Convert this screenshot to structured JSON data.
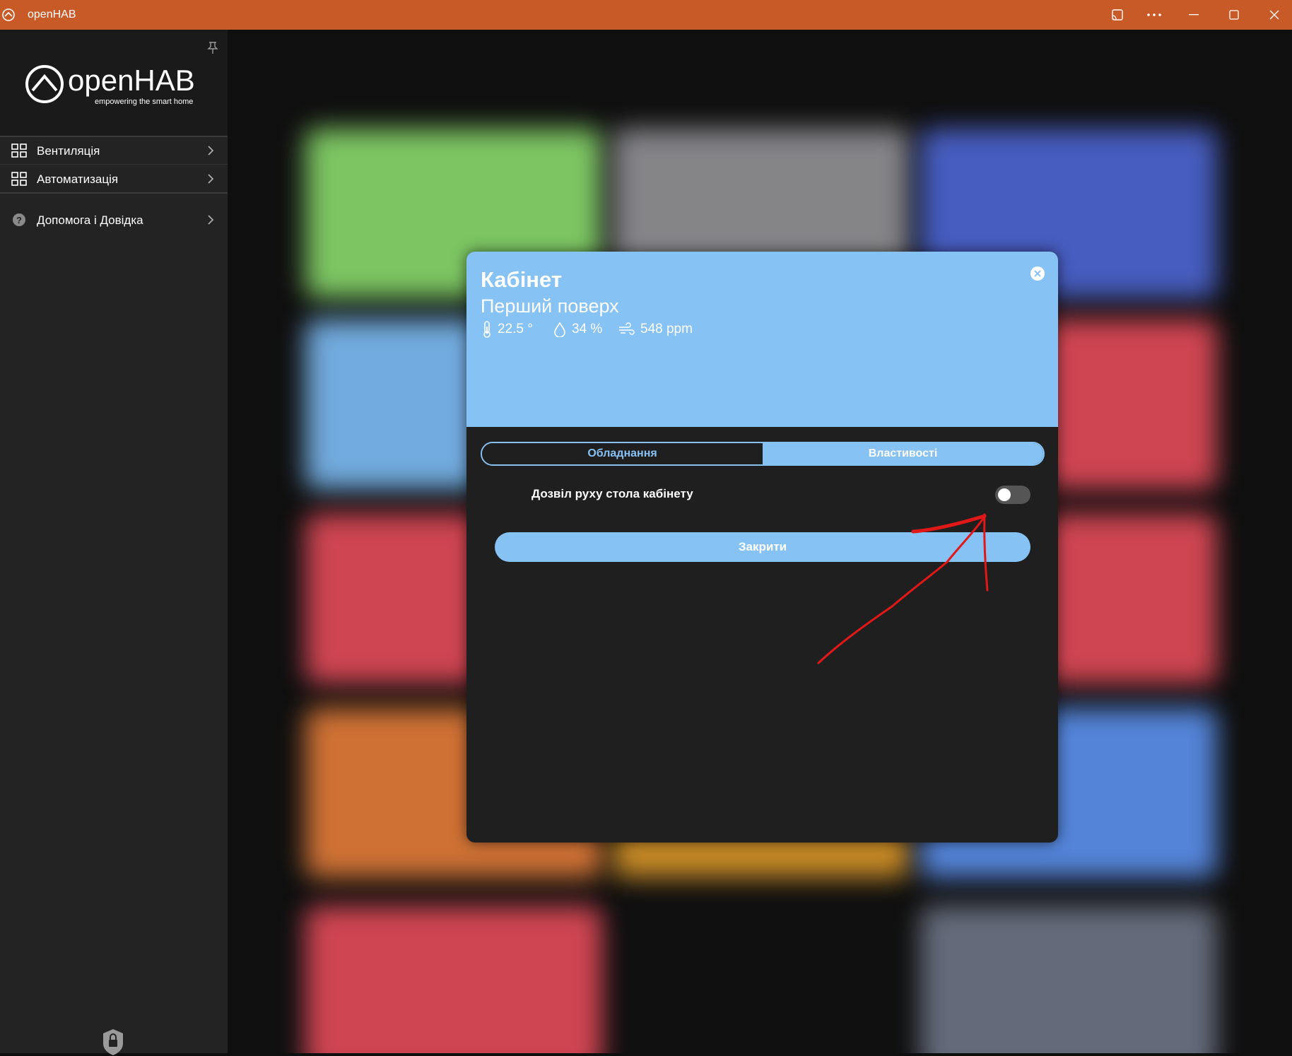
{
  "window": {
    "title": "openHAB"
  },
  "sidebar": {
    "logo_text": "openHAB",
    "logo_tagline": "empowering the smart home",
    "items": [
      {
        "label": "Вентиляція",
        "icon": "grid-icon"
      },
      {
        "label": "Автоматизація",
        "icon": "grid-icon"
      },
      {
        "label": "Допомога і Довідка",
        "icon": "help-icon"
      }
    ]
  },
  "dialog": {
    "title": "Кабінет",
    "subtitle": "Перший поверх",
    "stats": {
      "temperature": "22.5 °",
      "humidity": "34 %",
      "co2": "548 ppm"
    },
    "tabs": [
      "Обладнання",
      "Властивості"
    ],
    "active_tab": "Властивості",
    "setting_label": "Дозвіл руху стола кабінету",
    "setting_enabled": false,
    "close_label": "Закрити"
  },
  "colors": {
    "titlebar": "#c85a28",
    "accent": "#86c2f3",
    "annotation": "#e01818"
  }
}
